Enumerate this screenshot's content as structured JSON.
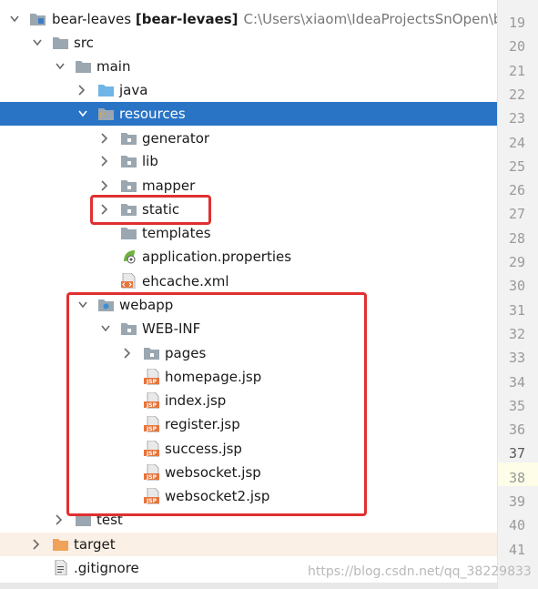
{
  "project": {
    "name": "bear-leaves",
    "module": "[bear-levaes]",
    "path": "C:\\Users\\xiaom\\IdeaProjectsSnOpen\\bea"
  },
  "tree": {
    "src": "src",
    "main": "main",
    "java": "java",
    "resources": "resources",
    "generator": "generator",
    "lib": "lib",
    "mapper": "mapper",
    "static": "static",
    "templates": "templates",
    "application_properties": "application.properties",
    "ehcache": "ehcache.xml",
    "webapp": "webapp",
    "web_inf": "WEB-INF",
    "pages": "pages",
    "homepage": "homepage.jsp",
    "index": "index.jsp",
    "register": "register.jsp",
    "success": "success.jsp",
    "websocket": "websocket.jsp",
    "websocket2": "websocket2.jsp",
    "test": "test",
    "target": "target",
    "gitignore": ".gitignore"
  },
  "gutter": {
    "lines": [
      "19",
      "20",
      "21",
      "22",
      "23",
      "24",
      "25",
      "26",
      "27",
      "28",
      "29",
      "30",
      "31",
      "32",
      "33",
      "34",
      "35",
      "36",
      "37",
      "38",
      "39",
      "40",
      "41"
    ],
    "current_line": "37"
  },
  "watermark": "https://blog.csdn.net/qq_38229833",
  "colors": {
    "selection": "#2a74c6",
    "folder": "#9aa7b0",
    "source_folder": "#6fb5e5",
    "excluded_folder": "#f0a25a",
    "annotation": "#e03030",
    "jsp_badge": "#e8743b"
  },
  "icons": {
    "folder": "folder-icon",
    "java_folder": "source-folder-icon",
    "resources_folder": "resources-folder-icon",
    "webapp_folder": "web-folder-icon",
    "target_folder": "excluded-folder-icon",
    "jsp_file": "jsp-file-icon",
    "xml_file": "xml-file-icon",
    "properties_file": "spring-properties-icon",
    "gitignore_file": "text-file-icon"
  }
}
